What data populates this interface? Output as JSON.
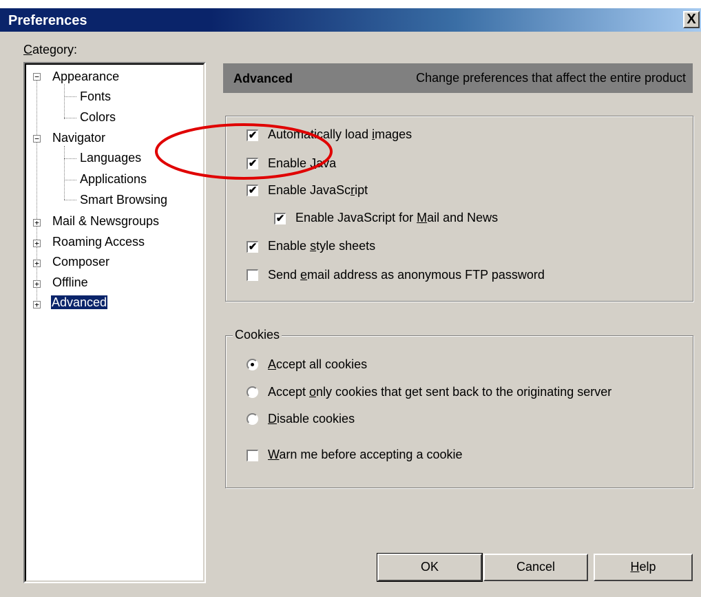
{
  "window": {
    "title": "Preferences",
    "close_glyph": "X"
  },
  "category_label": {
    "prefix": "",
    "underlined": "C",
    "rest": "ategory:"
  },
  "tree": {
    "appearance": "Appearance",
    "fonts": "Fonts",
    "colors": "Colors",
    "navigator": "Navigator",
    "languages": "Languages",
    "applications": "Applications",
    "smart_browsing": "Smart Browsing",
    "mail": "Mail & Newsgroups",
    "roaming": "Roaming Access",
    "composer": "Composer",
    "offline": "Offline",
    "advanced": "Advanced",
    "expand_glyph": "+",
    "collapse_glyph": "−"
  },
  "header": {
    "title": "Advanced",
    "description": "Change preferences that affect the entire product"
  },
  "options": {
    "auto_images": {
      "pre": "Automatically load ",
      "u": "i",
      "post": "mages",
      "checked": true
    },
    "java": {
      "pre": "Enable ",
      "u": "J",
      "post": "ava",
      "checked": true
    },
    "javascript": {
      "pre": "Enable JavaSc",
      "u": "r",
      "post": "ipt",
      "checked": true
    },
    "js_mail": {
      "pre": "Enable JavaScript for ",
      "u": "M",
      "post": "ail and News",
      "checked": true
    },
    "style": {
      "pre": "Enable ",
      "u": "s",
      "post": "tyle sheets",
      "checked": true
    },
    "ftp": {
      "pre": "Send ",
      "u": "e",
      "post": "mail address as anonymous FTP password",
      "checked": false
    }
  },
  "cookies": {
    "legend": "Cookies",
    "accept_all": {
      "pre": "",
      "u": "A",
      "post": "ccept all cookies",
      "selected": true
    },
    "accept_only": {
      "pre": "Accept ",
      "u": "o",
      "post": "nly cookies that get sent back to the originating server",
      "selected": false
    },
    "disable": {
      "pre": "",
      "u": "D",
      "post": "isable cookies",
      "selected": false
    },
    "warn": {
      "pre": "",
      "u": "W",
      "post": "arn me before accepting a cookie",
      "checked": false
    }
  },
  "check_glyph": "✔",
  "buttons": {
    "ok": "OK",
    "cancel": "Cancel",
    "help": {
      "pre": "",
      "u": "H",
      "post": "elp"
    }
  },
  "colors": {
    "titlebar": "#0a246a",
    "annotation": "#e00000",
    "selection": "#0a246a"
  }
}
